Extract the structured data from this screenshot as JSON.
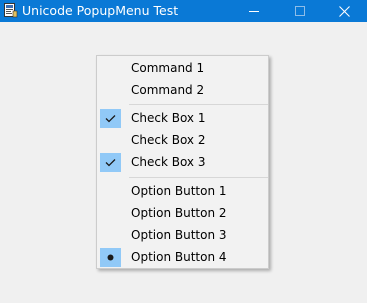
{
  "window": {
    "title": "Unicode PopupMenu Test",
    "app_icon": "app-icon",
    "controls": [
      "minimize-icon",
      "maximize-icon",
      "close-icon"
    ]
  },
  "menu": {
    "items": [
      {
        "label": "Command 1",
        "type": "command"
      },
      {
        "label": "Command 2",
        "type": "command"
      },
      {
        "label": "Check Box 1",
        "type": "checkbox",
        "checked": true
      },
      {
        "label": "Check Box 2",
        "type": "checkbox",
        "checked": false
      },
      {
        "label": "Check Box 3",
        "type": "checkbox",
        "checked": true
      },
      {
        "label": "Option Button 1",
        "type": "option",
        "selected": false
      },
      {
        "label": "Option Button 2",
        "type": "option",
        "selected": false
      },
      {
        "label": "Option Button 3",
        "type": "option",
        "selected": false
      },
      {
        "label": "Option Button 4",
        "type": "option",
        "selected": true
      }
    ]
  },
  "colors": {
    "titlebar": "#0a79d6",
    "check_highlight": "#91c9f7",
    "menu_background": "#f2f2f2"
  }
}
